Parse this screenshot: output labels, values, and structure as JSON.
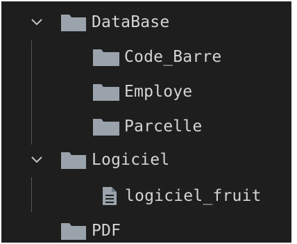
{
  "explorer": {
    "items": [
      {
        "label": "DataBase",
        "type": "folder",
        "expanded": true,
        "depth": 0,
        "chevron_icon": "chevron-down-icon",
        "icon": "folder-icon"
      },
      {
        "label": "Code_Barre",
        "type": "folder",
        "depth": 1,
        "icon": "folder-icon"
      },
      {
        "label": "Employe",
        "type": "folder",
        "depth": 1,
        "icon": "folder-icon"
      },
      {
        "label": "Parcelle",
        "type": "folder",
        "depth": 1,
        "icon": "folder-icon"
      },
      {
        "label": "Logiciel",
        "type": "folder",
        "expanded": true,
        "depth": 0,
        "chevron_icon": "chevron-down-icon",
        "icon": "folder-icon"
      },
      {
        "label": "logiciel_fruit",
        "type": "file",
        "depth": 1,
        "icon": "file-icon"
      },
      {
        "label": "PDF",
        "type": "folder",
        "depth": 0,
        "icon": "folder-icon"
      }
    ]
  },
  "colors": {
    "background": "#1e1e1e",
    "text": "#d4d4d4",
    "folder": "#9aa3ab",
    "chevron": "#c5c5c5",
    "indent_guide": "#585858"
  }
}
